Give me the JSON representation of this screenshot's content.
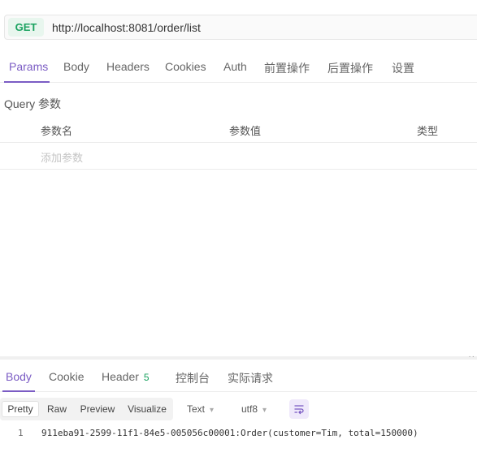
{
  "request": {
    "method": "GET",
    "url": "http://localhost:8081/order/list"
  },
  "request_tabs": [
    "Params",
    "Body",
    "Headers",
    "Cookies",
    "Auth",
    "前置操作",
    "后置操作",
    "设置"
  ],
  "params": {
    "title": "Query 参数",
    "columns": [
      "参数名",
      "参数值",
      "类型"
    ],
    "placeholder": "添加参数"
  },
  "response_tabs": {
    "body": "Body",
    "cookie": "Cookie",
    "header": "Header",
    "header_count": "5",
    "console": "控制台",
    "actual_request": "实际请求"
  },
  "view": {
    "modes": [
      "Pretty",
      "Raw",
      "Preview",
      "Visualize"
    ],
    "active_mode": "Pretty",
    "format": "Text",
    "encoding": "utf8"
  },
  "response_body": {
    "line_number": "1",
    "line_text": "911eba91-2599-11f1-84e5-005056c00001:Order(customer=Tim, total=150000)"
  },
  "colors": {
    "accent": "#7b5cc4",
    "method_green": "#1aa260"
  },
  "icons": {
    "dots": "more-dots-icon",
    "wrap": "word-wrap-icon",
    "chevron": "chevron-down-icon"
  }
}
